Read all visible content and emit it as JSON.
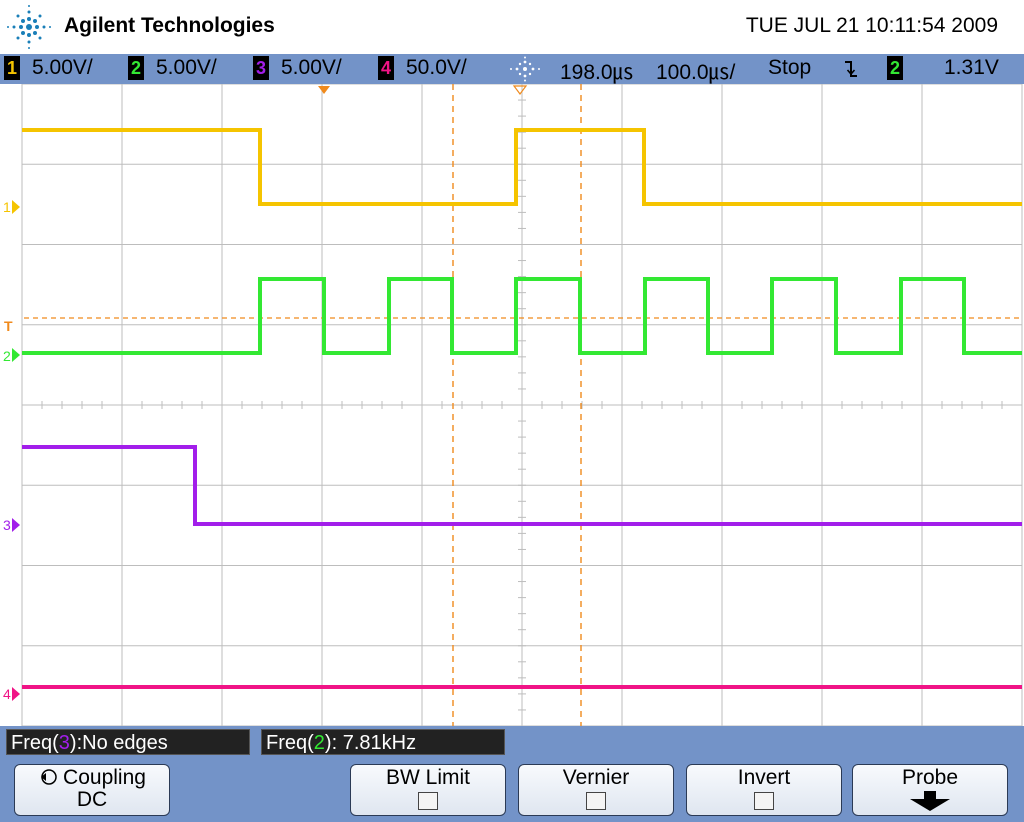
{
  "header": {
    "brand": "Agilent Technologies",
    "datetime": "TUE JUL 21 10:11:54 2009",
    "logo_icon": "agilent-spark-logo-icon"
  },
  "status_bar": {
    "channels": [
      {
        "number": "1",
        "scale": "5.00V/",
        "color": "#f5c400"
      },
      {
        "number": "2",
        "scale": "5.00V/",
        "color": "#33e833"
      },
      {
        "number": "3",
        "scale": "5.00V/",
        "color": "#a21eea"
      },
      {
        "number": "4",
        "scale": "50.0V/",
        "color": "#f01486"
      }
    ],
    "timebase_icon": "timebase-spark-icon",
    "delay": "198.0㎲",
    "timebase": "100.0㎲/",
    "run_state": "Stop",
    "trigger_slope_icon": "falling-edge-icon",
    "trigger_channel": "2",
    "trigger_level": "1.31V"
  },
  "plot": {
    "channel_markers": [
      "1",
      "2",
      "3",
      "4"
    ],
    "trigger_marker": "T",
    "colors": {
      "grid": "#bdbdbd",
      "cursor": "#f08a1c",
      "trigger_level": "#f08a1c"
    }
  },
  "measurements": [
    {
      "prefix": "Freq(",
      "channel": "3",
      "suffix": "):No edges",
      "channel_color": "#a21eea"
    },
    {
      "prefix": "Freq(",
      "channel": "2",
      "suffix": "): 7.81kHz",
      "channel_color": "#33e833"
    }
  ],
  "softkeys": {
    "coupling": {
      "label": "Coupling",
      "value": "DC",
      "icon": "rotate-arrow-icon"
    },
    "bw_limit": {
      "label": "BW Limit",
      "checked": false
    },
    "vernier": {
      "label": "Vernier",
      "checked": false
    },
    "invert": {
      "label": "Invert",
      "checked": false
    },
    "probe": {
      "label": "Probe",
      "icon": "down-arrow-icon"
    }
  }
}
